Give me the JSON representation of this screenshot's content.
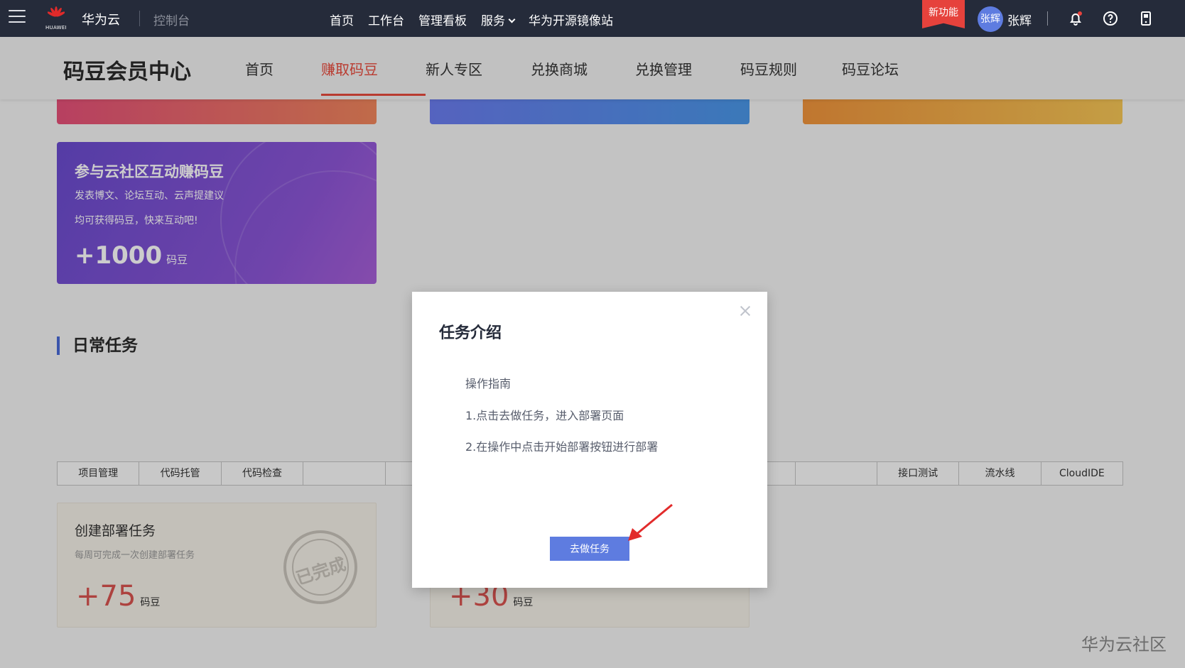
{
  "topbar": {
    "logo_text": "HUAWEI",
    "brand": "华为云",
    "console": "控制台",
    "nav": [
      "首页",
      "工作台",
      "管理看板",
      "服务",
      "华为开源镜像站"
    ],
    "new_feature": "新功能",
    "avatar_text": "张辉",
    "username": "张辉",
    "icons": [
      "bell-icon",
      "help-icon",
      "mobile-icon"
    ]
  },
  "subheader": {
    "title": "码豆会员中心",
    "nav": [
      "首页",
      "赚取码豆",
      "新人专区",
      "兑换商城",
      "兑换管理",
      "码豆规则",
      "码豆论坛"
    ],
    "active": "赚取码豆"
  },
  "cards": {
    "interact": {
      "title": "参与云社区互动赚码豆",
      "desc1": "发表博文、论坛互动、云声提建议",
      "desc2": "均可获得码豆，快来互动吧!",
      "points": "+1000",
      "unit": "码豆"
    }
  },
  "daily": {
    "title": "日常任务",
    "tabs": [
      "项目管理",
      "代码托管",
      "代码检查",
      "",
      "",
      "",
      "",
      "",
      "",
      "",
      "接口测试",
      "流水线",
      "CloudIDE"
    ],
    "tasks": [
      {
        "title": "创建部署任务",
        "desc": "每周可完成一次创建部署任务",
        "points": "+75",
        "unit": "码豆",
        "stamp": "已完成"
      },
      {
        "title": "",
        "desc": "",
        "points": "+30",
        "unit": "码豆"
      }
    ]
  },
  "modal": {
    "title": "任务介绍",
    "guide_title": "操作指南",
    "step1": "1.点击去做任务，进入部署页面",
    "step2": "2.在操作中点击开始部署按钮进行部署",
    "button": "去做任务"
  },
  "watermark": "华为云社区",
  "colors": {
    "topbar": "#252b3a",
    "accent": "#e84a3c",
    "primary": "#5e7ce0"
  }
}
